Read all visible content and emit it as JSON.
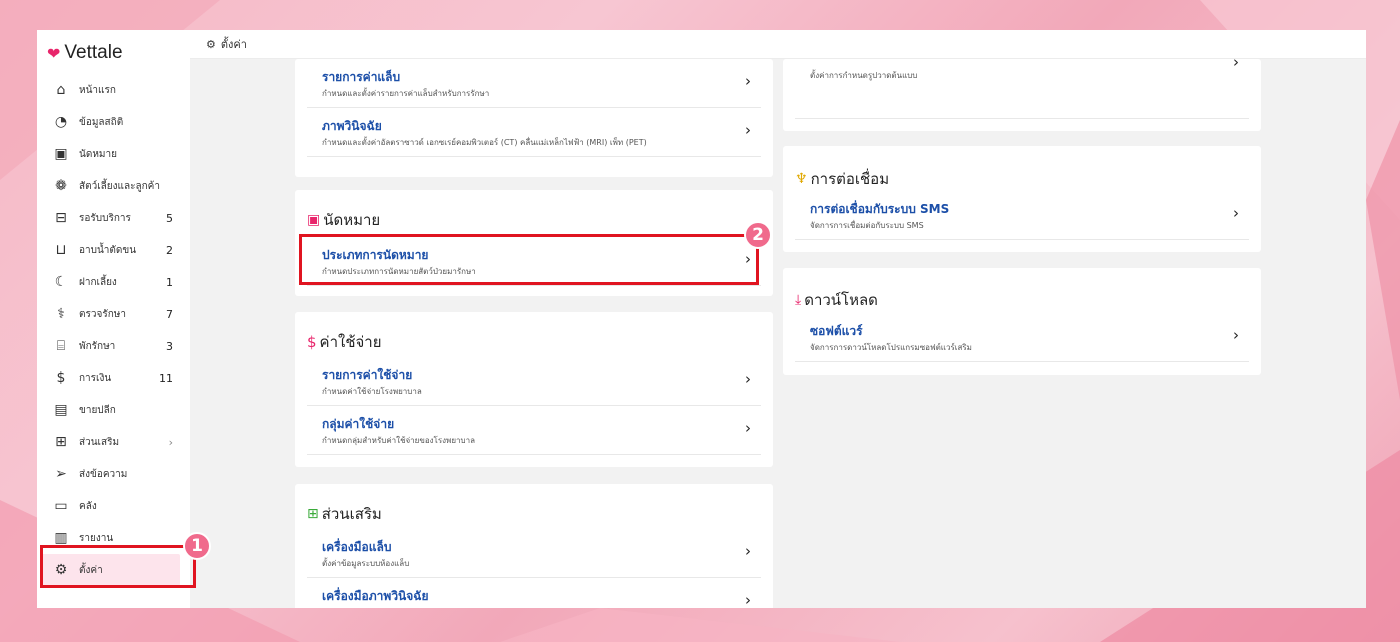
{
  "app": {
    "brand": "Vettale",
    "breadcrumb": "ตั้งค่า"
  },
  "sidebar": {
    "items": [
      {
        "label": "หน้าแรก",
        "count": ""
      },
      {
        "label": "ข้อมูลสถิติ",
        "count": ""
      },
      {
        "label": "นัดหมาย",
        "count": ""
      },
      {
        "label": "สัตว์เลี้ยงและลูกค้า",
        "count": ""
      },
      {
        "label": "รอรับบริการ",
        "count": "5"
      },
      {
        "label": "อาบน้ำตัดขน",
        "count": "2"
      },
      {
        "label": "ฝากเลี้ยง",
        "count": "1"
      },
      {
        "label": "ตรวจรักษา",
        "count": "7"
      },
      {
        "label": "พักรักษา",
        "count": "3"
      },
      {
        "label": "การเงิน",
        "count": "11"
      },
      {
        "label": "ขายปลีก",
        "count": ""
      },
      {
        "label": "ส่วนเสริม",
        "count": "›"
      },
      {
        "label": "ส่งข้อความ",
        "count": ""
      },
      {
        "label": "คลัง",
        "count": ""
      },
      {
        "label": "รายงาน",
        "count": ""
      },
      {
        "label": "ตั้งค่า",
        "count": ""
      }
    ]
  },
  "steps": {
    "one": "1",
    "two": "2"
  },
  "left": {
    "top_rows": [
      {
        "title": "รายการค่าแล็บ",
        "desc": "กำหนดและตั้งค่ารายการค่าแล็บสำหรับการรักษา"
      },
      {
        "title": "ภาพวินิจฉัย",
        "desc": "กำหนดและตั้งค่าอัลตราซาวด์ เอกซเรย์คอมพิวเตอร์ (CT) คลื่นแม่เหล็กไฟฟ้า (MRI) เพ็ท (PET)"
      }
    ],
    "appointment": {
      "title": "นัดหมาย",
      "rows": [
        {
          "title": "ประเภทการนัดหมาย",
          "desc": "กำหนดประเภทการนัดหมายสัตว์ป่วยมารักษา"
        }
      ]
    },
    "expense": {
      "title": "ค่าใช้จ่าย",
      "rows": [
        {
          "title": "รายการค่าใช้จ่าย",
          "desc": "กำหนดค่าใช้จ่ายโรงพยาบาล"
        },
        {
          "title": "กลุ่มค่าใช้จ่าย",
          "desc": "กำหนดกลุ่มสำหรับค่าใช้จ่ายของโรงพยาบาล"
        }
      ]
    },
    "addons": {
      "title": "ส่วนเสริม",
      "rows": [
        {
          "title": "เครื่องมือแล็บ",
          "desc": "ตั้งค่าข้อมูลระบบห้องแล็บ"
        },
        {
          "title": "เครื่องมือภาพวินิจฉัย",
          "desc": ""
        }
      ]
    }
  },
  "right": {
    "top_rows": [
      {
        "title": "",
        "desc": "ตั้งค่าการกำหนดรูปวาดต้นแบบ"
      }
    ],
    "connection": {
      "title": "การต่อเชื่อม",
      "rows": [
        {
          "title": "การต่อเชื่อมกับระบบ SMS",
          "desc": "จัดการการเชื่อมต่อกับระบบ SMS"
        }
      ]
    },
    "download": {
      "title": "ดาวน์โหลด",
      "rows": [
        {
          "title": "ซอฟต์แวร์",
          "desc": "จัดการการดาวน์โหลดโปรแกรมซอฟต์แวร์เสริม"
        }
      ]
    }
  },
  "icons": {
    "sidebar": [
      "home-icon",
      "stats-icon",
      "calendar-icon",
      "paw-icon",
      "sofa-icon",
      "bath-icon",
      "moon-icon",
      "stethoscope-icon",
      "bed-icon",
      "money-icon",
      "register-icon",
      "plus-box-icon",
      "send-icon",
      "archive-icon",
      "chart-icon",
      "gear-icon"
    ]
  },
  "colors": {
    "accent": "#e8256b",
    "highlight": "#e01420",
    "link": "#1c4fa8",
    "active_bg": "#fde4ec"
  }
}
